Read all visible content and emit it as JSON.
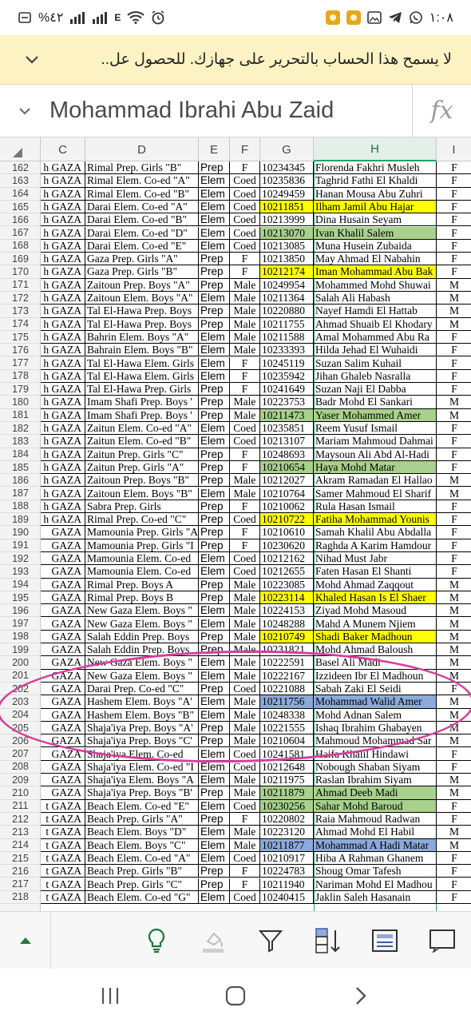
{
  "status_bar": {
    "time": "١:٠٨",
    "battery": "%٤٢",
    "network": "E"
  },
  "banner": {
    "text": "لا يسمح هذا الحساب بالتحرير على جهازك. للحصول عل.."
  },
  "formula_bar": {
    "value": "Mohammad Ibrahi Abu Zaid",
    "fx_label": "fx"
  },
  "columns": [
    "C",
    "D",
    "E",
    "F",
    "G",
    "H",
    "I"
  ],
  "rows": [
    {
      "n": "162",
      "c": "h GAZA",
      "d": "Rimal Prep. Girls \"B\"",
      "e": "Prep",
      "f": "F",
      "g": "10234345",
      "h": "Florenda Fakhri Musleh",
      "i": "F",
      "hl": ""
    },
    {
      "n": "163",
      "c": "h GAZA",
      "d": "Rimal Elem. Co-ed \"A\"",
      "e": "Elem",
      "f": "Coed",
      "g": "10235836",
      "h": "Taghrid Fathi El Khaldi",
      "i": "F",
      "hl": ""
    },
    {
      "n": "164",
      "c": "h GAZA",
      "d": "Rimal Elem. Co-ed \"B\"",
      "e": "Elem",
      "f": "Coed",
      "g": "10249459",
      "h": "Hanan Mousa Abu Zuhri",
      "i": "F",
      "hl": ""
    },
    {
      "n": "165",
      "c": "h GAZA",
      "d": "Darai Elem. Co-ed \"A\"",
      "e": "Elem",
      "f": "Coed",
      "g": "10211851",
      "h": "Ilham Jamil Abu Hajar",
      "i": "F",
      "hl": "yellow"
    },
    {
      "n": "166",
      "c": "h GAZA",
      "d": "Darai Elem. Co-ed \"B\"",
      "e": "Elem",
      "f": "Coed",
      "g": "10213999",
      "h": "Dina Husain Seyam",
      "i": "F",
      "hl": ""
    },
    {
      "n": "167",
      "c": "h GAZA",
      "d": "Darai Elem. Co-ed \"D\"",
      "e": "Elem",
      "f": "Coed",
      "g": "10213070",
      "h": "Ivan Khalil Salem",
      "i": "F",
      "hl": "green"
    },
    {
      "n": "168",
      "c": "h GAZA",
      "d": "Darai Elem. Co-ed \"E\"",
      "e": "Elem",
      "f": "Coed",
      "g": "10213085",
      "h": "Muna Husein Zubaida",
      "i": "F",
      "hl": ""
    },
    {
      "n": "169",
      "c": "h GAZA",
      "d": "Gaza Prep. Girls \"A\"",
      "e": "Prep",
      "f": "F",
      "g": "10213850",
      "h": "May Ahmad El Nabahin",
      "i": "F",
      "hl": ""
    },
    {
      "n": "170",
      "c": "h GAZA",
      "d": "Gaza Prep. Girls \"B\"",
      "e": "Prep",
      "f": "F",
      "g": "10212174",
      "h": "Iman Mohammad Abu Bak",
      "i": "F",
      "hl": "yellow"
    },
    {
      "n": "171",
      "c": "h GAZA",
      "d": "Zaitoun Prep. Boys \"A\"",
      "e": "Prep",
      "f": "Male",
      "g": "10249954",
      "h": "Mohammed Mohd Shuwai",
      "i": "M",
      "hl": ""
    },
    {
      "n": "172",
      "c": "h GAZA",
      "d": "Zaitoun Elem. Boys \"A\"",
      "e": "Elem",
      "f": "Male",
      "g": "10211364",
      "h": "Salah Ali Habash",
      "i": "M",
      "hl": ""
    },
    {
      "n": "173",
      "c": "h GAZA",
      "d": "Tal El-Hawa Prep. Boys",
      "e": "Prep",
      "f": "Male",
      "g": "10220880",
      "h": "Nayef Hamdi El Hattab",
      "i": "M",
      "hl": ""
    },
    {
      "n": "174",
      "c": "h GAZA",
      "d": "Tal El-Hawa Prep. Boys",
      "e": "Prep",
      "f": "Male",
      "g": "10211755",
      "h": "Ahmad Shuaib El Khodary",
      "i": "M",
      "hl": ""
    },
    {
      "n": "175",
      "c": "h GAZA",
      "d": "Bahrin Elem. Boys \"A\"",
      "e": "Elem",
      "f": "Male",
      "g": "10211588",
      "h": "Amal Mohammed Abu Ra",
      "i": "F",
      "hl": ""
    },
    {
      "n": "176",
      "c": "h GAZA",
      "d": "Bahrain Elem. Boys \"B\"",
      "e": "Elem",
      "f": "Male",
      "g": "10233393",
      "h": "Hilda Jehad El Wuhaidi",
      "i": "F",
      "hl": ""
    },
    {
      "n": "177",
      "c": "h GAZA",
      "d": "Tal El-Hawa Elem. Girls",
      "e": "Elem",
      "f": "F",
      "g": "10245119",
      "h": "Suzan Salim Kuhail",
      "i": "F",
      "hl": ""
    },
    {
      "n": "178",
      "c": "h GAZA",
      "d": "Tal El-Hawa Elem. Girls",
      "e": "Elem",
      "f": "F",
      "g": "10235942",
      "h": "Jihan Ghaleb Nasralla",
      "i": "F",
      "hl": ""
    },
    {
      "n": "179",
      "c": "h GAZA",
      "d": "Tal El-Hawa Prep. Girls",
      "e": "Prep",
      "f": "F",
      "g": "10241649",
      "h": "Suzan Naji El Dabba",
      "i": "F",
      "hl": ""
    },
    {
      "n": "180",
      "c": "h GAZA",
      "d": "Imam Shafi Prep. Boys '",
      "e": "Prep",
      "f": "Male",
      "g": "10223753",
      "h": "Badr Mohd El Sankari",
      "i": "M",
      "hl": ""
    },
    {
      "n": "181",
      "c": "h GAZA",
      "d": "Imam Shafi Prep. Boys '",
      "e": "Prep",
      "f": "Male",
      "g": "10211473",
      "h": "Yaser Mohammed Amer",
      "i": "M",
      "hl": "green"
    },
    {
      "n": "182",
      "c": "h GAZA",
      "d": "Zaitun Elem. Co-ed \"A\"",
      "e": "Elem",
      "f": "Coed",
      "g": "10235851",
      "h": "Reem Yusuf Ismail",
      "i": "F",
      "hl": ""
    },
    {
      "n": "183",
      "c": "h GAZA",
      "d": "Zaitun Elem. Co-ed \"B\"",
      "e": "Elem",
      "f": "Coed",
      "g": "10213107",
      "h": "Mariam Mahmoud Dahmai",
      "i": "F",
      "hl": ""
    },
    {
      "n": "184",
      "c": "h GAZA",
      "d": "Zaitun Prep. Girls \"C\"",
      "e": "Prep",
      "f": "F",
      "g": "10248693",
      "h": "Maysoun Ali Abd Al-Hadi",
      "i": "F",
      "hl": ""
    },
    {
      "n": "185",
      "c": "h GAZA",
      "d": "Zaitun Prep. Girls \"A\"",
      "e": "Prep",
      "f": "F",
      "g": "10210654",
      "h": "Haya Mohd Matar",
      "i": "F",
      "hl": "green"
    },
    {
      "n": "186",
      "c": "h GAZA",
      "d": "Zaitoun Prep. Boys \"B\"",
      "e": "Prep",
      "f": "Male",
      "g": "10212027",
      "h": "Akram Ramadan El Hallao",
      "i": "M",
      "hl": ""
    },
    {
      "n": "187",
      "c": "h GAZA",
      "d": "Zaitoun Elem. Boys \"B\"",
      "e": "Elem",
      "f": "Male",
      "g": "10210764",
      "h": "Samer Mahmoud El Sharif",
      "i": "M",
      "hl": ""
    },
    {
      "n": "188",
      "c": "h GAZA",
      "d": "Sabra Prep. Girls",
      "e": "Prep",
      "f": "F",
      "g": "10210062",
      "h": "Rula Hasan Ismail",
      "i": "F",
      "hl": ""
    },
    {
      "n": "189",
      "c": "h GAZA",
      "d": "Rimal Prep. Co-ed \"C\"",
      "e": "Prep",
      "f": "Coed",
      "g": "10210722",
      "h": "Fatiha Mohammad Younis",
      "i": "F",
      "hl": "yellow"
    },
    {
      "n": "190",
      "c": "GAZA",
      "d": "Mamounia Prep. Girls \"A",
      "e": "Prep",
      "f": "F",
      "g": "10210610",
      "h": "Samah Khalil Abu Abdalla",
      "i": "F",
      "hl": ""
    },
    {
      "n": "191",
      "c": "GAZA",
      "d": "Mamounia Prep. Girls \"I",
      "e": "Prep",
      "f": "F",
      "g": "10230620",
      "h": "Raghda A Karim Hamdour",
      "i": "F",
      "hl": ""
    },
    {
      "n": "192",
      "c": "GAZA",
      "d": "Mamounia Elem. Co-ed",
      "e": "Elem",
      "f": "Coed",
      "g": "10212162",
      "h": "Nihad Must Jabr",
      "i": "F",
      "hl": ""
    },
    {
      "n": "193",
      "c": "GAZA",
      "d": "Mamounia Elem. Co-ed",
      "e": "Elem",
      "f": "Coed",
      "g": "10212655",
      "h": "Faten Hasan El Shanti",
      "i": "F",
      "hl": ""
    },
    {
      "n": "194",
      "c": "GAZA",
      "d": "Rimal Prep. Boys A",
      "e": "Prep",
      "f": "Male",
      "g": "10223085",
      "h": "Mohd Ahmad Zaqqout",
      "i": "M",
      "hl": ""
    },
    {
      "n": "195",
      "c": "GAZA",
      "d": "Rimal Prep. Boys B",
      "e": "Prep",
      "f": "Male",
      "g": "10223114",
      "h": "Khaled Hasan Is El Shaer",
      "i": "M",
      "hl": "yellow"
    },
    {
      "n": "196",
      "c": "GAZA",
      "d": "New Gaza Elem. Boys \"",
      "e": "Elem",
      "f": "Male",
      "g": "10224153",
      "h": "Ziyad Mohd Masoud",
      "i": "M",
      "hl": ""
    },
    {
      "n": "197",
      "c": "GAZA",
      "d": "New Gaza Elem. Boys \"",
      "e": "Elem",
      "f": "Male",
      "g": "10248288",
      "h": "Mahd A Munem Njiem",
      "i": "M",
      "hl": ""
    },
    {
      "n": "198",
      "c": "GAZA",
      "d": "Salah Eddin Prep. Boys",
      "e": "Prep",
      "f": "Male",
      "g": "10210749",
      "h": "Shadi Baker Madhoun",
      "i": "M",
      "hl": "yellow"
    },
    {
      "n": "199",
      "c": "GAZA",
      "d": "Salah Eddin Prep. Boys",
      "e": "Prep",
      "f": "Male",
      "g": "10231821",
      "h": "Mohd Ahmad Baloush",
      "i": "M",
      "hl": ""
    },
    {
      "n": "200",
      "c": "GAZA",
      "d": "New Gaza Elem. Boys \"",
      "e": "Elem",
      "f": "Male",
      "g": "10222591",
      "h": "Basel Ali Madi",
      "i": "M",
      "hl": ""
    },
    {
      "n": "201",
      "c": "GAZA",
      "d": "New Gaza Elem. Boys \"",
      "e": "Elem",
      "f": "Male",
      "g": "10222167",
      "h": "Izzideen Ibr El Madhoun",
      "i": "M",
      "hl": ""
    },
    {
      "n": "202",
      "c": "GAZA",
      "d": "Darai Prep. Co-ed \"C\"",
      "e": "Prep",
      "f": "Coed",
      "g": "10221088",
      "h": "Sabah Zaki El Seidi",
      "i": "F",
      "hl": ""
    },
    {
      "n": "203",
      "c": "GAZA",
      "d": "Hashem Elem. Boys \"A'",
      "e": "Elem",
      "f": "Male",
      "g": "10211756",
      "h": "Mohammad Walid Amer",
      "i": "M",
      "hl": "blue"
    },
    {
      "n": "204",
      "c": "GAZA",
      "d": "Hashem Elem. Boys \"B\"",
      "e": "Elem",
      "f": "Male",
      "g": "10248338",
      "h": "Mohd Adnan Salem",
      "i": "M",
      "hl": ""
    },
    {
      "n": "205",
      "c": "GAZA",
      "d": "Shaja'iya Prep. Boys \"A'",
      "e": "Prep",
      "f": "Male",
      "g": "10221555",
      "h": "Ishaq Ibrahim Ghabayen",
      "i": "M",
      "hl": ""
    },
    {
      "n": "206",
      "c": "GAZA",
      "d": "Shaja'iya Prep. Boys \"C'",
      "e": "Prep",
      "f": "Male",
      "g": "10210604",
      "h": "Mahmoud Mohammad Sar",
      "i": "M",
      "hl": ""
    },
    {
      "n": "207",
      "c": "GAZA",
      "d": "Shaja'iya Elem. Co-ed",
      "e": "Elem",
      "f": "Coed",
      "g": "10241581",
      "h": "Haifa Khalil Hindawi",
      "i": "F",
      "hl": ""
    },
    {
      "n": "208",
      "c": "GAZA",
      "d": "Shaja'iya Elem. Co-ed \"I",
      "e": "Elem",
      "f": "Coed",
      "g": "10212648",
      "h": "Nobough Shaban Siyam",
      "i": "F",
      "hl": ""
    },
    {
      "n": "209",
      "c": "GAZA",
      "d": "Shaja'iya Elem. Boys \"A",
      "e": "Elem",
      "f": "Male",
      "g": "10211975",
      "h": "Raslan Ibrahim Siyam",
      "i": "M",
      "hl": ""
    },
    {
      "n": "210",
      "c": "GAZA",
      "d": "Shaja'iya Prep. Boys \"B'",
      "e": "Prep",
      "f": "Male",
      "g": "10211879",
      "h": "Ahmad Deeb Madi",
      "i": "M",
      "hl": "green"
    },
    {
      "n": "211",
      "c": "t GAZA",
      "d": "Beach Elem. Co-ed \"E\"",
      "e": "Elem",
      "f": "Coed",
      "g": "10230256",
      "h": "Sahar Mohd Baroud",
      "i": "F",
      "hl": "green"
    },
    {
      "n": "212",
      "c": "t GAZA",
      "d": "Beach Prep. Girls \"A\"",
      "e": "Prep",
      "f": "F",
      "g": "10220802",
      "h": "Raia Mahmoud Radwan",
      "i": "F",
      "hl": ""
    },
    {
      "n": "213",
      "c": "t GAZA",
      "d": "Beach Elem. Boys \"D\"",
      "e": "Elem",
      "f": "Male",
      "g": "10223120",
      "h": "Ahmad Mohd El Habil",
      "i": "M",
      "hl": ""
    },
    {
      "n": "214",
      "c": "t GAZA",
      "d": "Beach Elem. Boys \"C\"",
      "e": "Elem",
      "f": "Male",
      "g": "10211877",
      "h": "Mohammad A Hadi Matar",
      "i": "M",
      "hl": "blue"
    },
    {
      "n": "215",
      "c": "t GAZA",
      "d": "Beach Elem. Co-ed \"A\"",
      "e": "Elem",
      "f": "Coed",
      "g": "10210917",
      "h": "Hiba A Rahman Ghanem",
      "i": "F",
      "hl": ""
    },
    {
      "n": "216",
      "c": "t GAZA",
      "d": "Beach Prep. Girls \"B\"",
      "e": "Prep",
      "f": "F",
      "g": "10224783",
      "h": "Shoug Omar Tafesh",
      "i": "F",
      "hl": ""
    },
    {
      "n": "217",
      "c": "t GAZA",
      "d": "Beach Prep. Girls \"C\"",
      "e": "Prep",
      "f": "F",
      "g": "10211940",
      "h": "Nariman Mohd El Madhou",
      "i": "F",
      "hl": ""
    },
    {
      "n": "218",
      "c": "t GAZA",
      "d": "Beach Elem. Co-ed \"G\"",
      "e": "Elem",
      "f": "Coed",
      "g": "10240415",
      "h": "Jaklin Saleh Hasanain",
      "i": "F",
      "hl": ""
    }
  ],
  "toolbar": {
    "items": [
      "expand-icon",
      "lightbulb-icon",
      "fill-color-icon",
      "filter-icon",
      "sort-icon",
      "card-view-icon",
      "comment-icon"
    ]
  },
  "colors": {
    "highlight_yellow": "#ffff00",
    "highlight_green": "#a9d18e",
    "highlight_blue": "#8ea9db",
    "annotation_pink": "#d63f9d",
    "excel_green": "#1f7a3e"
  }
}
